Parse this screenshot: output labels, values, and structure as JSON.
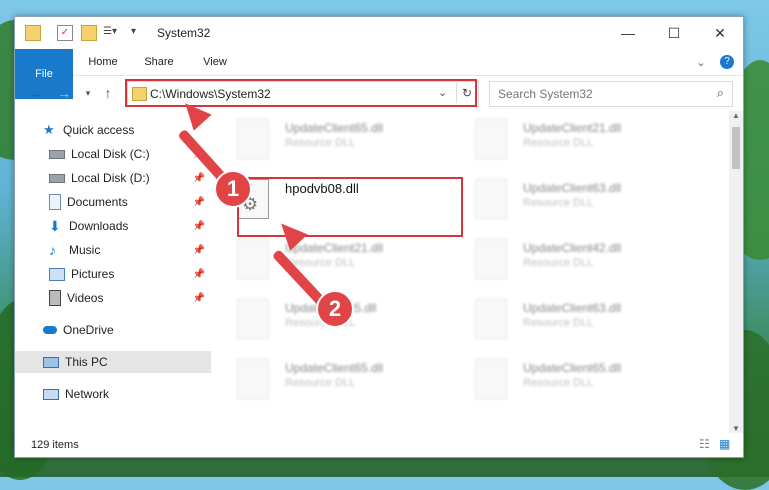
{
  "window": {
    "title": "System32"
  },
  "ribbon": {
    "file": "File",
    "home": "Home",
    "share": "Share",
    "view": "View"
  },
  "address": {
    "path": "C:\\Windows\\System32",
    "search_placeholder": "Search System32"
  },
  "sidebar": {
    "items": [
      {
        "label": "Quick access"
      },
      {
        "label": "Local Disk (C:)"
      },
      {
        "label": "Local Disk (D:)"
      },
      {
        "label": "Documents"
      },
      {
        "label": "Downloads"
      },
      {
        "label": "Music"
      },
      {
        "label": "Pictures"
      },
      {
        "label": "Videos"
      },
      {
        "label": "OneDrive"
      },
      {
        "label": "This PC"
      },
      {
        "label": "Network"
      }
    ]
  },
  "files": {
    "left": [
      {
        "name": "UpdateClient65.dll",
        "type": "Resource DLL"
      },
      {
        "name": "hpodvb08.dll",
        "type": ""
      },
      {
        "name": "UpdateClient21.dll",
        "type": "Resource DLL"
      },
      {
        "name": "UpdateClient5.dll",
        "type": "Resource DLL"
      },
      {
        "name": "UpdateClient65.dll",
        "type": "Resource DLL"
      }
    ],
    "right": [
      {
        "name": "UpdateClient21.dll",
        "type": "Resource DLL"
      },
      {
        "name": "UpdateClient63.dll",
        "type": "Resource DLL"
      },
      {
        "name": "UpdateClient42.dll",
        "type": "Resource DLL"
      },
      {
        "name": "UpdateClient63.dll",
        "type": "Resource DLL"
      },
      {
        "name": "UpdateClient65.dll",
        "type": "Resource DLL"
      }
    ]
  },
  "status": {
    "count": "129 items"
  },
  "annotations": {
    "step1": "1",
    "step2": "2"
  },
  "colors": {
    "accent": "#1979ca",
    "highlight": "#d9333a",
    "arrow": "#e04447"
  }
}
